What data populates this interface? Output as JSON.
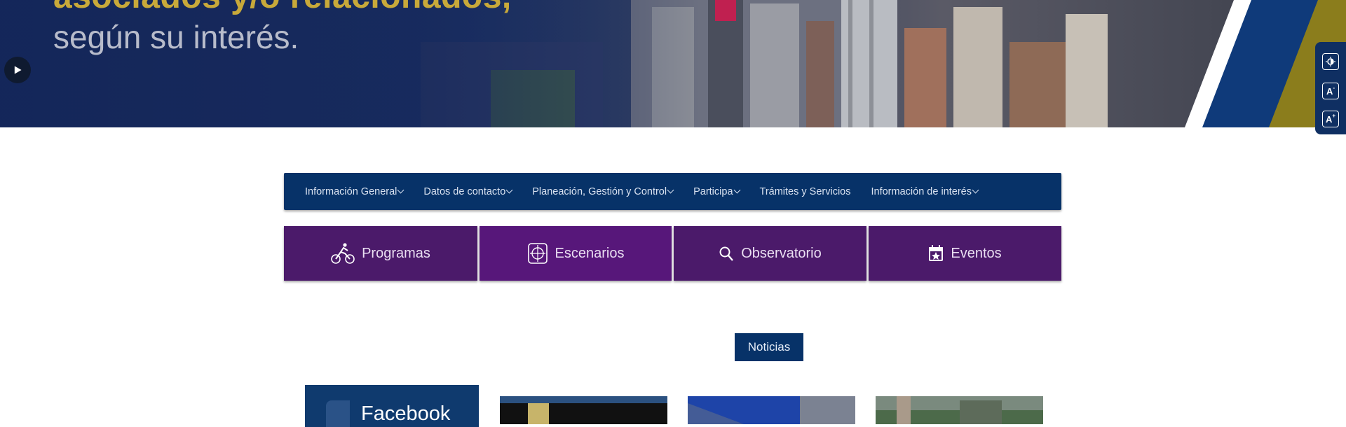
{
  "hero": {
    "headline_line1": "asociados y/o relacionados,",
    "headline_line2": "según su interés.",
    "play_icon": "play-icon"
  },
  "accessibility": {
    "contrast_icon": "contrast-icon",
    "decrease_text": "A",
    "increase_text": "A"
  },
  "nav": {
    "items": [
      {
        "label": "Información General",
        "has_dropdown": true
      },
      {
        "label": "Datos de contacto",
        "has_dropdown": true
      },
      {
        "label": "Planeación, Gestión y Control",
        "has_dropdown": true
      },
      {
        "label": "Participa",
        "has_dropdown": true
      },
      {
        "label": "Trámites y Servicios",
        "has_dropdown": false
      },
      {
        "label": "Información de interés",
        "has_dropdown": true
      }
    ]
  },
  "tiles": [
    {
      "label": "Programas",
      "icon": "cyclist-icon"
    },
    {
      "label": "Escenarios",
      "icon": "stadium-icon"
    },
    {
      "label": "Observatorio",
      "icon": "magnifier-icon"
    },
    {
      "label": "Eventos",
      "icon": "calendar-star-icon"
    }
  ],
  "news_button": "Noticias",
  "facebook_card": {
    "label": "Facebook",
    "icon": "facebook-icon"
  },
  "colors": {
    "nav_blue": "#073268",
    "tile_purple": "#4b1a6a",
    "tile_purple_active": "#57177a",
    "accent_gold": "#c8a93a"
  }
}
